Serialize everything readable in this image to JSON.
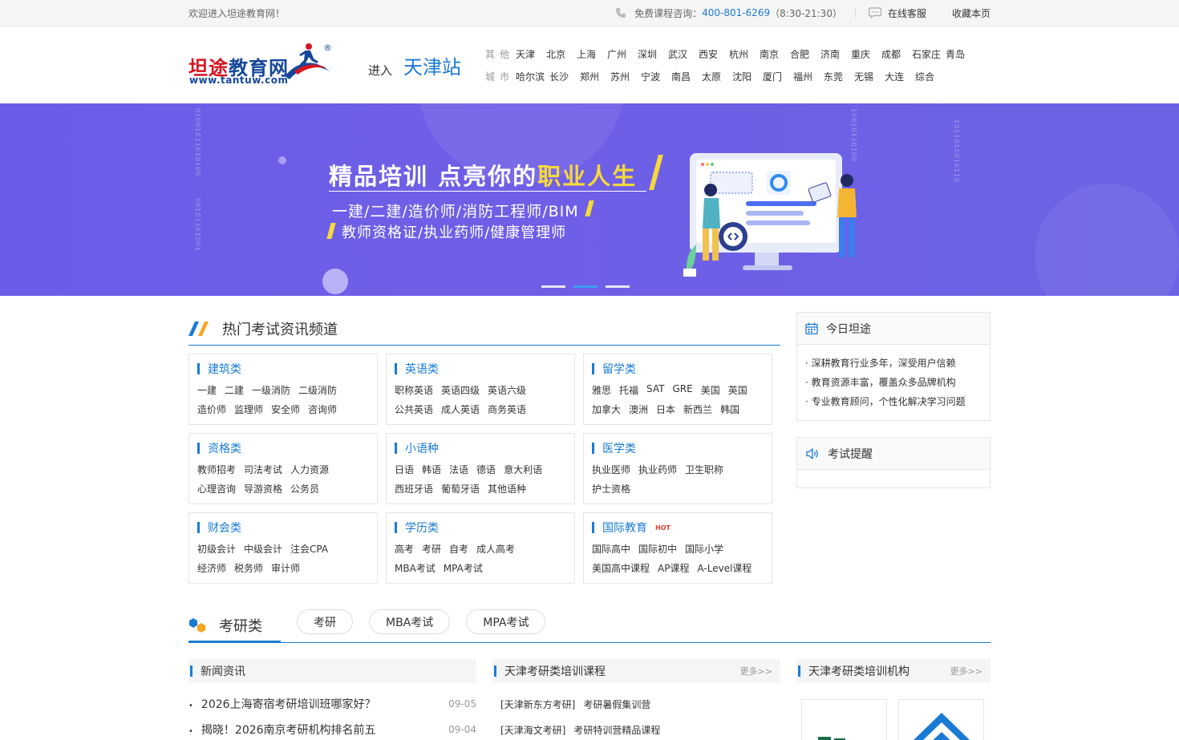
{
  "topbar": {
    "welcome": "欢迎进入坦途教育网！",
    "consult_label": "免费课程咨询：",
    "phone": "400-801-6269",
    "hours": "（8:30-21:30）",
    "online_service": "在线客服",
    "favorite": "收藏本页"
  },
  "header": {
    "logo_cn_red": "坦途",
    "logo_cn_blue": "教育网",
    "logo_en": "www.tantuw.com",
    "logo_reg": "®",
    "enter": "进入",
    "station": "天津站",
    "other_label": "其他",
    "city_label": "城市",
    "cities_row1": [
      "天津",
      "北京",
      "上海",
      "广州",
      "深圳",
      "武汉",
      "西安",
      "杭州",
      "南京",
      "合肥",
      "济南",
      "重庆",
      "成都",
      "石家庄",
      "青岛"
    ],
    "cities_row2": [
      "哈尔滨",
      "长沙",
      "郑州",
      "苏州",
      "宁波",
      "南昌",
      "太原",
      "沈阳",
      "厦门",
      "福州",
      "东莞",
      "无锡",
      "大连",
      "综合"
    ]
  },
  "banner": {
    "title_white": "精品培训 点亮你的",
    "title_yellow": "职业人生",
    "subtitle1": "一建/二建/造价师/消防工程师/BIM",
    "subtitle2": "教师资格证/执业药师/健康管理师",
    "slides": 3,
    "active_slide": 2,
    "accent_yellow": "#f6d93b",
    "bg_color": "#6a5ee8"
  },
  "hot": {
    "title": "热门考试资讯频道",
    "categories": [
      {
        "title": "建筑类",
        "rows": [
          [
            "一建",
            "二建",
            "一级消防",
            "二级消防"
          ],
          [
            "造价师",
            "监理师",
            "安全师",
            "咨询师"
          ]
        ]
      },
      {
        "title": "英语类",
        "rows": [
          [
            "职称英语",
            "英语四级",
            "英语六级"
          ],
          [
            "公共英语",
            "成人英语",
            "商务英语"
          ]
        ]
      },
      {
        "title": "留学类",
        "rows": [
          [
            "雅思",
            "托福",
            "SAT",
            "GRE",
            "美国",
            "英国"
          ],
          [
            "加拿大",
            "澳洲",
            "日本",
            "新西兰",
            "韩国"
          ]
        ]
      },
      {
        "title": "资格类",
        "rows": [
          [
            "教师招考",
            "司法考试",
            "人力资源"
          ],
          [
            "心理咨询",
            "导游资格",
            "公务员"
          ]
        ]
      },
      {
        "title": "小语种",
        "rows": [
          [
            "日语",
            "韩语",
            "法语",
            "德语",
            "意大利语"
          ],
          [
            "西班牙语",
            "葡萄牙语",
            "其他语种"
          ]
        ]
      },
      {
        "title": "医学类",
        "rows": [
          [
            "执业医师",
            "执业药师",
            "卫生职称"
          ],
          [
            "护士资格"
          ]
        ]
      },
      {
        "title": "财会类",
        "rows": [
          [
            "初级会计",
            "中级会计",
            "注会CPA"
          ],
          [
            "经济师",
            "税务师",
            "审计师"
          ]
        ]
      },
      {
        "title": "学历类",
        "rows": [
          [
            "高考",
            "考研",
            "自考",
            "成人高考"
          ],
          [
            "MBA考试",
            "MPA考试"
          ]
        ]
      },
      {
        "title": "国际教育",
        "hot": "HOT",
        "rows": [
          [
            "国际高中",
            "国际初中",
            "国际小学"
          ],
          [
            "美国高中课程",
            "AP课程",
            "A-Level课程"
          ]
        ]
      }
    ]
  },
  "today": {
    "title": "今日坦途",
    "items": [
      "· 深耕教育行业多年，深受用户信赖",
      "· 教育资源丰富，覆盖众多品牌机构",
      "· 专业教育顾问，个性化解决学习问题"
    ]
  },
  "reminder": {
    "title": "考试提醒"
  },
  "kaoyan": {
    "title": "考研类",
    "tabs": [
      "考研",
      "MBA考试",
      "MPA考试"
    ],
    "news_title": "新闻资讯",
    "news": [
      {
        "title": "2026上海寄宿考研培训班哪家好？",
        "date": "09-05"
      },
      {
        "title": "揭晓！2026南京考研机构排名前五",
        "date": "09-04"
      }
    ],
    "courses_title": "天津考研类培训课程",
    "courses_more": "更多>>",
    "courses": [
      {
        "inst": "[天津新东方考研]",
        "name": "考研暑假集训营"
      },
      {
        "inst": "[天津海文考研]",
        "name": "考研特训营精品课程"
      }
    ],
    "orgs_title": "天津考研类培训机构",
    "orgs_more": "更多>>"
  }
}
